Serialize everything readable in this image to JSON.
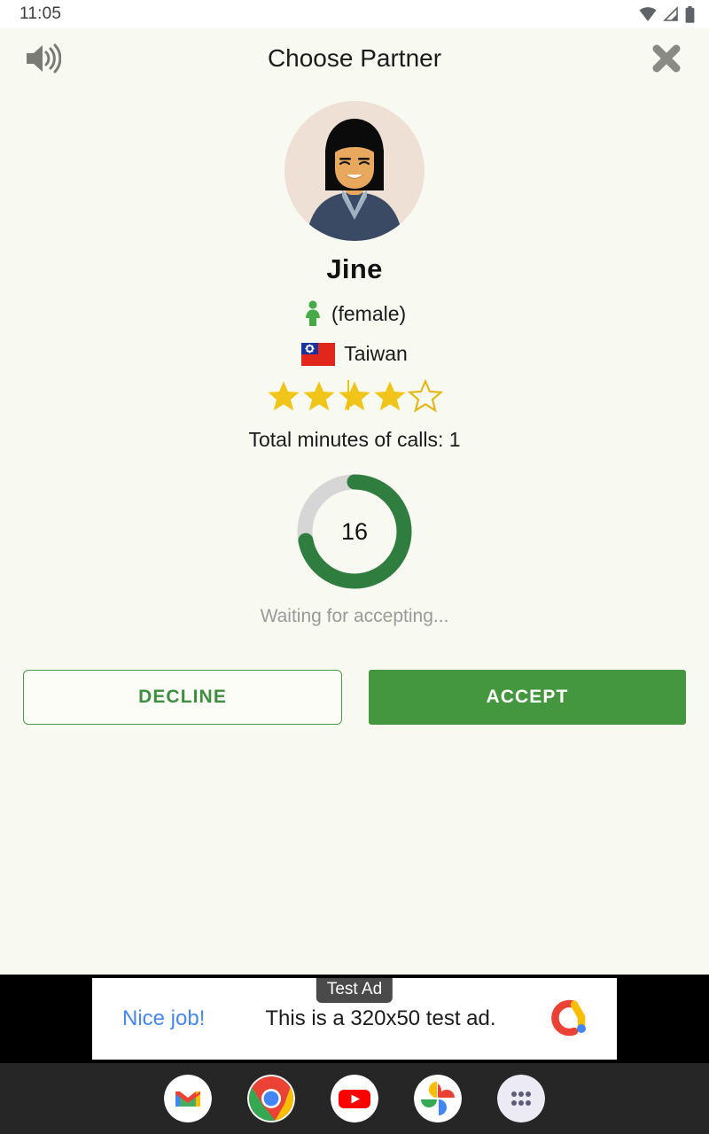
{
  "statusbar": {
    "time": "11:05",
    "icons": [
      "wifi-icon",
      "cellular-signal-icon",
      "battery-icon"
    ]
  },
  "appbar": {
    "title": "Choose Partner",
    "speaker_icon": "speaker-on-icon",
    "close_icon": "close-icon"
  },
  "profile": {
    "avatar_alt": "female-avatar",
    "name": "Jine",
    "gender_label": "(female)",
    "gender_icon": "female-figure-icon",
    "country": "Taiwan",
    "flag_icon": "taiwan-flag-icon",
    "rating": 4,
    "rating_max": 5,
    "minutes_label": "Total minutes of calls: 1"
  },
  "timer": {
    "value": "16",
    "progress_percent": 72,
    "status_text": "Waiting for accepting...",
    "track_color": "#d6d6d6",
    "progress_color": "#2f7d3f"
  },
  "actions": {
    "decline_label": "DECLINE",
    "accept_label": "ACCEPT",
    "accent_color": "#44963f"
  },
  "ad": {
    "badge": "Test Ad",
    "cta": "Nice job!",
    "text": "This is a 320x50 test ad.",
    "logo": "admob-logo-icon"
  },
  "dock": {
    "items": [
      {
        "name": "gmail",
        "label": "Gmail"
      },
      {
        "name": "chrome",
        "label": "Chrome"
      },
      {
        "name": "youtube",
        "label": "YouTube"
      },
      {
        "name": "photos",
        "label": "Photos"
      },
      {
        "name": "app-drawer",
        "label": "All apps"
      }
    ]
  },
  "colors": {
    "app_background": "#f8faf2",
    "star_gold": "#f5c518",
    "green": "#44963f"
  }
}
